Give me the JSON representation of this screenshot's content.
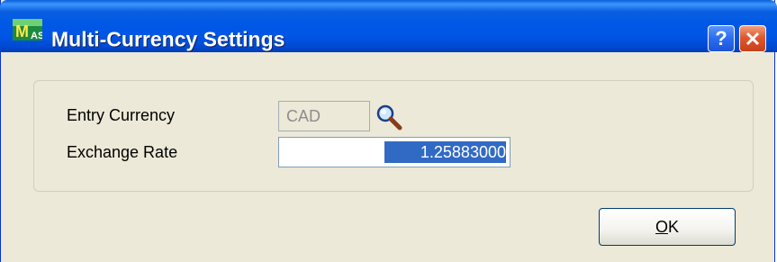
{
  "window": {
    "title": "Multi-Currency Settings",
    "app_icon": "sage-mas-icon",
    "help_glyph": "?",
    "accent": "#0055e5",
    "close_color": "#e0582a"
  },
  "form": {
    "entry_currency_label": "Entry Currency",
    "entry_currency_value": "CAD",
    "lookup_icon": "magnifier-icon",
    "exchange_rate_label": "Exchange Rate",
    "exchange_rate_value": "1.25883000"
  },
  "buttons": {
    "ok_label_first": "O",
    "ok_label_rest": "K"
  }
}
